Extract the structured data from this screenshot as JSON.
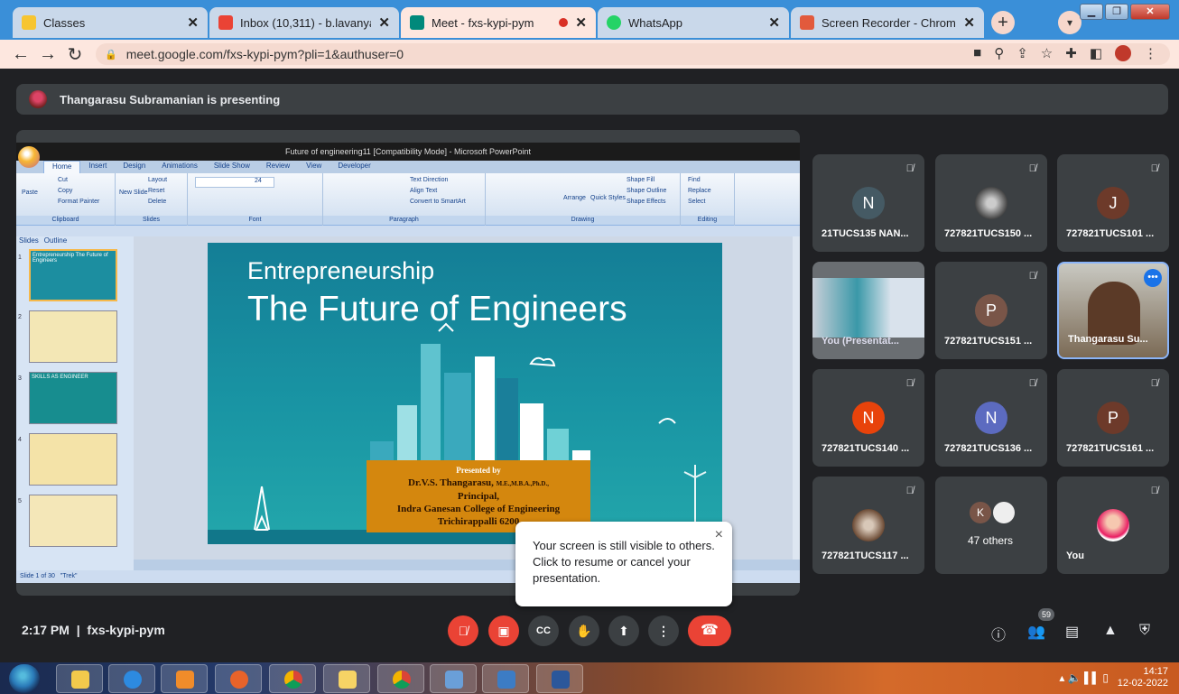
{
  "tabs": [
    {
      "title": "Classes",
      "icon": "classroom-icon",
      "color": "#f7c531",
      "active": false
    },
    {
      "title": "Inbox (10,311) - b.lavanya@sk",
      "icon": "gmail-icon",
      "color": "#ea4335",
      "active": false
    },
    {
      "title": "Meet - fxs-kypi-pym",
      "icon": "meet-icon",
      "color": "#00897b",
      "active": true,
      "recording": true
    },
    {
      "title": "WhatsApp",
      "icon": "whatsapp-icon",
      "color": "#25d366",
      "active": false
    },
    {
      "title": "Screen Recorder - Chrome We",
      "icon": "recorder-icon",
      "color": "#e25a3c",
      "active": false
    }
  ],
  "new_tab_label": "+",
  "url": "meet.google.com/fxs-kypi-pym?pli=1&authuser=0",
  "presenting_banner": "Thangarasu Subramanian is presenting",
  "ppt": {
    "window_title": "Future of engineering11 [Compatibility Mode] - Microsoft PowerPoint",
    "ribbon_tabs": [
      "Home",
      "Insert",
      "Design",
      "Animations",
      "Slide Show",
      "Review",
      "View",
      "Developer"
    ],
    "groups": {
      "clipboard": {
        "label": "Clipboard",
        "paste": "Paste",
        "cut": "Cut",
        "copy": "Copy",
        "format_painter": "Format Painter"
      },
      "slides": {
        "label": "Slides",
        "new_slide": "New Slide",
        "layout": "Layout",
        "reset": "Reset",
        "delete": "Delete"
      },
      "font": {
        "label": "Font",
        "size": "24"
      },
      "paragraph": {
        "label": "Paragraph",
        "text_direction": "Text Direction",
        "align_text": "Align Text",
        "smartart": "Convert to SmartArt"
      },
      "drawing": {
        "label": "Drawing",
        "arrange": "Arrange",
        "quick_styles": "Quick Styles",
        "shape_fill": "Shape Fill",
        "shape_outline": "Shape Outline",
        "shape_effects": "Shape Effects"
      },
      "editing": {
        "label": "Editing",
        "find": "Find",
        "replace": "Replace",
        "select": "Select"
      }
    },
    "pane_tabs": [
      "Slides",
      "Outline"
    ],
    "thumbnails": [
      {
        "num": "1",
        "title": "Entrepreneurship The Future of Engineers",
        "bg": "#1c8ea0"
      },
      {
        "num": "2",
        "title": "",
        "bg": "#f3e7b5"
      },
      {
        "num": "3",
        "title": "SKILLS AS ENGINEER",
        "bg": "#178d8f"
      },
      {
        "num": "4",
        "title": "",
        "bg": "#f4e3a8"
      },
      {
        "num": "5",
        "title": "",
        "bg": "#f4e7b8"
      }
    ],
    "slide": {
      "title1": "Entrepreneurship",
      "title2": "The Future of Engineers",
      "presented_by": "Presented by",
      "presenter": "Dr.V.S. Thangarasu,",
      "degrees": "M.E.,M.B.A.,Ph.D.,",
      "role": "Principal,",
      "college": "Indra Ganesan College of Engineering",
      "city": "Trichirappalli 6200"
    },
    "status": {
      "slide_of": "Slide 1 of 30",
      "theme": "\"Trek\""
    }
  },
  "participants": [
    {
      "name": "21TUCS135 NAN...",
      "initial": "N",
      "color": "#455a64",
      "muted": true
    },
    {
      "name": "727821TUCS150 ...",
      "initial": "",
      "color": "#6d6d6d",
      "muted": true,
      "photo": true
    },
    {
      "name": "727821TUCS101 ...",
      "initial": "J",
      "color": "#6d3a2a",
      "muted": true
    },
    {
      "name": "You (Presentat...",
      "initial": "",
      "color": "#3c4043",
      "muted": false,
      "presentation": true
    },
    {
      "name": "727821TUCS151 ...",
      "initial": "P",
      "color": "#795548",
      "muted": true
    },
    {
      "name": "Thangarasu Su...",
      "initial": "",
      "color": "#9aa",
      "muted": false,
      "video": true,
      "active_speaker": true
    },
    {
      "name": "727821TUCS140 ...",
      "initial": "N",
      "color": "#e8430b",
      "muted": true
    },
    {
      "name": "727821TUCS136 ...",
      "initial": "N",
      "color": "#5c6bc0",
      "muted": true
    },
    {
      "name": "727821TUCS161 ...",
      "initial": "P",
      "color": "#6d3a2a",
      "muted": true
    },
    {
      "name": "727821TUCS117 ...",
      "initial": "",
      "color": "#8d6e63",
      "muted": true,
      "photo": true
    },
    {
      "name": "47 others",
      "initial": "K",
      "color": "#795548",
      "muted": false,
      "others": true
    },
    {
      "name": "You",
      "initial": "",
      "color": "#f48fb1",
      "muted": true,
      "photo": true
    }
  ],
  "meeting": {
    "time": "2:17 PM",
    "code": "fxs-kypi-pym",
    "participant_count": "59"
  },
  "tooltip": {
    "text": "Your screen is still visible to others. Click to resume or cancel your presentation.",
    "close": "×"
  },
  "taskbar": {
    "time": "14:17",
    "date": "12-02-2022"
  }
}
